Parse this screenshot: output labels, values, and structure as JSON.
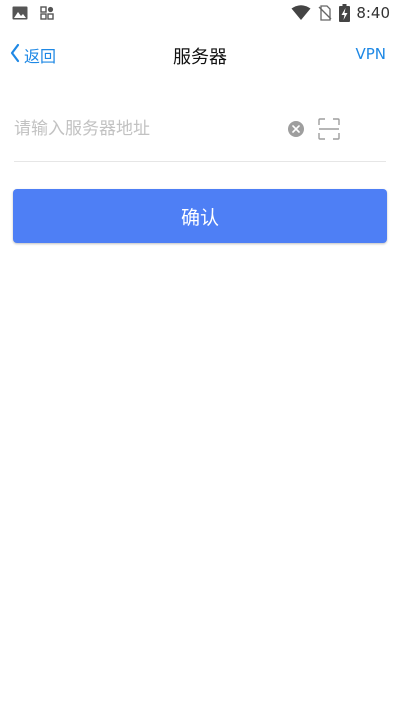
{
  "status_bar": {
    "time": "8:40",
    "left_icons": [
      "image-icon",
      "app-grid-icon"
    ],
    "right_icons": [
      "wifi-icon",
      "no-sim-icon",
      "battery-charging-icon"
    ]
  },
  "nav": {
    "back_label": "返回",
    "title": "服务器",
    "right_action": "VPN"
  },
  "form": {
    "server_input": {
      "value": "",
      "placeholder": "请输入服务器地址"
    },
    "clear_icon": "clear-icon",
    "scan_icon": "scan-icon"
  },
  "confirm_button": {
    "label": "确认"
  },
  "colors": {
    "accent": "#1e88e5",
    "primary_button": "#4e7ff5",
    "placeholder": "#c2c2c2",
    "divider": "#e6e6e6"
  }
}
